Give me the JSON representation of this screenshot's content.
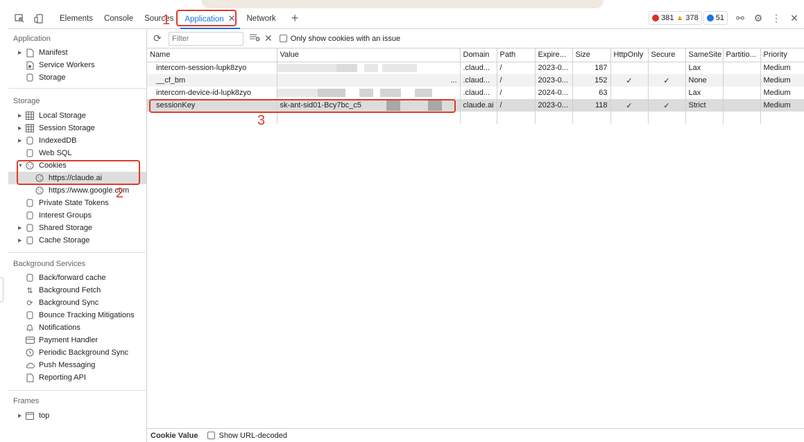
{
  "toolbar": {
    "tabs": [
      {
        "label": "Elements"
      },
      {
        "label": "Console"
      },
      {
        "label": "Sources"
      },
      {
        "label": "Application"
      },
      {
        "label": "Network"
      }
    ],
    "active_tab": "Application",
    "counters": {
      "errors": "381",
      "warnings": "378",
      "info": "51"
    },
    "colors": {
      "error": "#d93025",
      "warning": "#e8a200",
      "info": "#1a73e8",
      "accent": "#1a73e8",
      "annotation": "#e0392b"
    }
  },
  "sidebar": {
    "application": {
      "title": "Application",
      "items": [
        "Manifest",
        "Service Workers",
        "Storage"
      ]
    },
    "storage": {
      "title": "Storage",
      "items": [
        "Local Storage",
        "Session Storage",
        "IndexedDB",
        "Web SQL",
        "Cookies",
        "https://claude.ai",
        "https://www.google.com",
        "Private State Tokens",
        "Interest Groups",
        "Shared Storage",
        "Cache Storage"
      ]
    },
    "background": {
      "title": "Background Services",
      "items": [
        "Back/forward cache",
        "Background Fetch",
        "Background Sync",
        "Bounce Tracking Mitigations",
        "Notifications",
        "Payment Handler",
        "Periodic Background Sync",
        "Push Messaging",
        "Reporting API"
      ]
    },
    "frames": {
      "title": "Frames",
      "items": [
        "top"
      ]
    }
  },
  "filterbar": {
    "placeholder": "Filter",
    "only_issue_label": "Only show cookies with an issue"
  },
  "table": {
    "columns": [
      "Name",
      "Value",
      "Domain",
      "Path",
      "Expire...",
      "Size",
      "HttpOnly",
      "Secure",
      "SameSite",
      "Partitio...",
      "Priority"
    ],
    "rows": [
      {
        "name": "intercom-session-lupk8zyo",
        "value": "",
        "domain": ".claud...",
        "path": "/",
        "expires": "2023-0...",
        "size": "187",
        "httponly": "",
        "secure": "",
        "samesite": "Lax",
        "partition": "",
        "priority": "Medium"
      },
      {
        "name": "__cf_bm",
        "value": "...",
        "domain": ".claud...",
        "path": "/",
        "expires": "2023-0...",
        "size": "152",
        "httponly": "✓",
        "secure": "✓",
        "samesite": "None",
        "partition": "",
        "priority": "Medium"
      },
      {
        "name": "intercom-device-id-lupk8zyo",
        "value": "",
        "domain": ".claud...",
        "path": "/",
        "expires": "2024-0...",
        "size": "63",
        "httponly": "",
        "secure": "",
        "samesite": "Lax",
        "partition": "",
        "priority": "Medium"
      },
      {
        "name": "sessionKey",
        "value": "sk-ant-sid01-Bcy7bc_c5",
        "domain": "claude.ai",
        "path": "/",
        "expires": "2023-0...",
        "size": "118",
        "httponly": "✓",
        "secure": "✓",
        "samesite": "Strict",
        "partition": "",
        "priority": "Medium"
      }
    ]
  },
  "bottombar": {
    "cookie_value_label": "Cookie Value",
    "url_decoded_label": "Show URL-decoded"
  },
  "annotations": [
    "1",
    "2",
    "3"
  ]
}
